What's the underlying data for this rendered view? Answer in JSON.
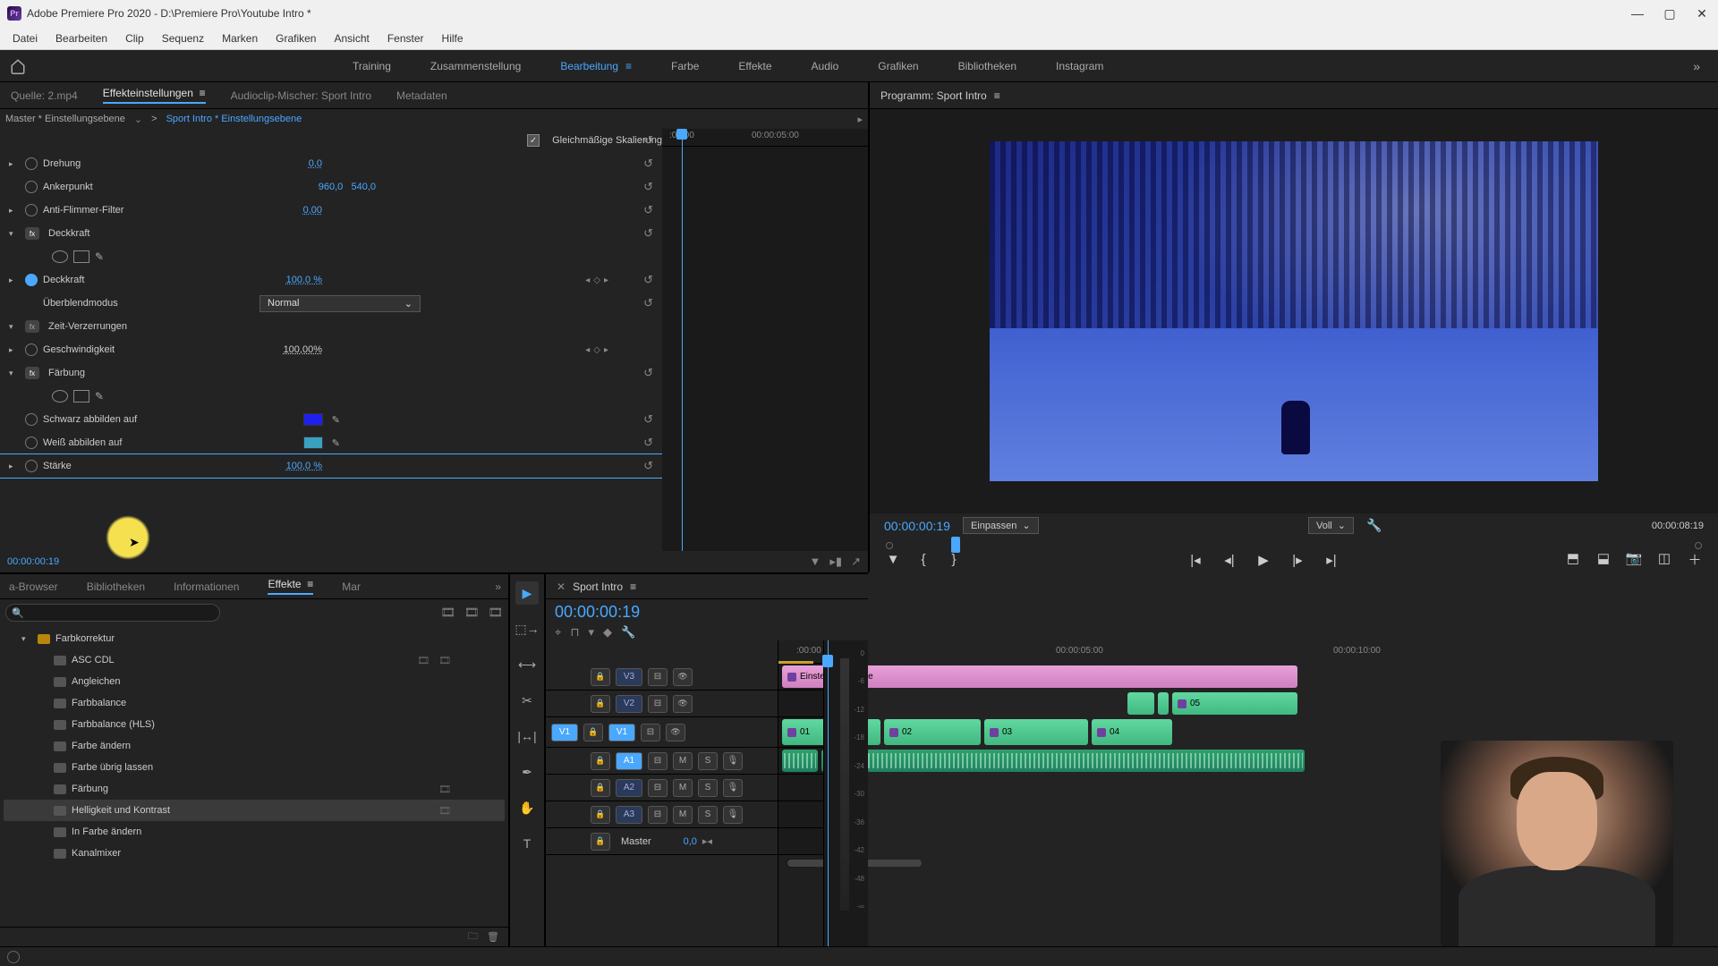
{
  "titlebar": {
    "app_abbr": "Pr",
    "title": "Adobe Premiere Pro 2020 - D:\\Premiere Pro\\Youtube Intro *"
  },
  "menu": [
    "Datei",
    "Bearbeiten",
    "Clip",
    "Sequenz",
    "Marken",
    "Grafiken",
    "Ansicht",
    "Fenster",
    "Hilfe"
  ],
  "workspaces": {
    "items": [
      "Training",
      "Zusammenstellung",
      "Bearbeitung",
      "Farbe",
      "Effekte",
      "Audio",
      "Grafiken",
      "Bibliotheken",
      "Instagram"
    ],
    "active_index": 2
  },
  "source_tabs": {
    "items": [
      "Quelle: 2.mp4",
      "Effekteinstellungen",
      "Audioclip-Mischer: Sport Intro",
      "Metadaten"
    ],
    "active_index": 1
  },
  "effect_controls": {
    "master": "Master * Einstellungsebene",
    "clip": "Sport Intro * Einstellungsebene",
    "timeline_labels": [
      ":00:00",
      "00:00:05:00"
    ],
    "playhead_time": "00:00:00:19",
    "props": {
      "uniform_scale": "Gleichmäßige Skalierung",
      "rotation": {
        "label": "Drehung",
        "value": "0,0"
      },
      "anchor": {
        "label": "Ankerpunkt",
        "x": "960,0",
        "y": "540,0"
      },
      "flicker": {
        "label": "Anti-Flimmer-Filter",
        "value": "0,00"
      },
      "opacity_group": "Deckkraft",
      "opacity": {
        "label": "Deckkraft",
        "value": "100,0 %"
      },
      "blend": {
        "label": "Überblendmodus",
        "value": "Normal"
      },
      "timeremap_group": "Zeit-Verzerrungen",
      "speed": {
        "label": "Geschwindigkeit",
        "value": "100,00%"
      },
      "tint_group": "Färbung",
      "map_black": "Schwarz abbilden auf",
      "map_white": "Weiß abbilden auf",
      "amount": {
        "label": "Stärke",
        "value": "100,0 %"
      }
    }
  },
  "program": {
    "title": "Programm: Sport Intro",
    "current": "00:00:00:19",
    "fit": "Einpassen",
    "quality": "Voll",
    "duration": "00:00:08:19"
  },
  "effects_browser": {
    "tabs": [
      "a-Browser",
      "Bibliotheken",
      "Informationen",
      "Effekte",
      "Mar"
    ],
    "active_index": 3,
    "search_placeholder": "",
    "folder": "Farbkorrektur",
    "items": [
      "ASC CDL",
      "Angleichen",
      "Farbbalance",
      "Farbbalance (HLS)",
      "Farbe ändern",
      "Farbe übrig lassen",
      "Färbung",
      "Helligkeit und Kontrast",
      "In Farbe ändern",
      "Kanalmixer"
    ]
  },
  "timeline": {
    "title": "Sport Intro",
    "timecode": "00:00:00:19",
    "ruler": [
      ":00:00",
      "00:00:05:00",
      "00:00:10:00"
    ],
    "tracks": {
      "v3": "V3",
      "v2": "V2",
      "v1": "V1",
      "v1_src": "V1",
      "a1": "A1",
      "a2": "A2",
      "a3": "A3",
      "master": "Master",
      "master_val": "0,0",
      "mute": "M",
      "solo": "S"
    },
    "clips": {
      "adj": "Einstellungsebene",
      "v2_05": "05",
      "v1_01": "01",
      "v1_02": "02",
      "v1_03": "03",
      "v1_04": "04"
    }
  },
  "audio_meter": [
    "0",
    "-6",
    "-12",
    "-18",
    "-24",
    "-30",
    "-36",
    "-42",
    "-48",
    "-∞"
  ]
}
